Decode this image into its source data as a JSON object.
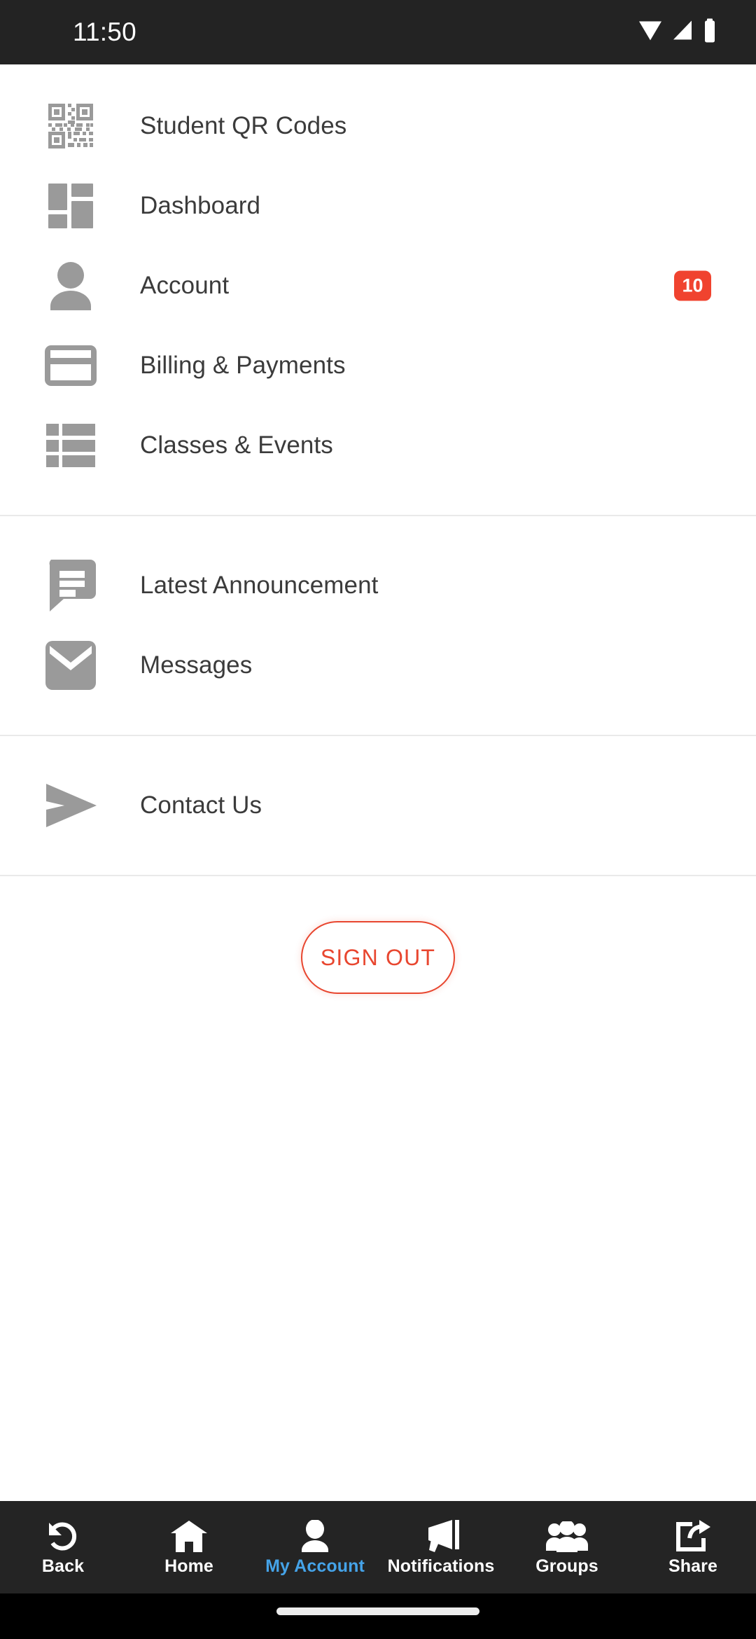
{
  "status_bar": {
    "time": "11:50",
    "icons": [
      "wifi-icon",
      "cell-signal-icon",
      "battery-icon"
    ],
    "background": "#232323"
  },
  "menu": {
    "groups": [
      {
        "items": [
          {
            "label": "Student QR Codes",
            "icon": "qr-code-icon",
            "badge": null
          },
          {
            "label": "Dashboard",
            "icon": "dashboard-grid-icon",
            "badge": null
          },
          {
            "label": "Account",
            "icon": "person-icon",
            "badge": "10"
          },
          {
            "label": "Billing & Payments",
            "icon": "credit-card-icon",
            "badge": null
          },
          {
            "label": "Classes & Events",
            "icon": "list-icon",
            "badge": null
          }
        ]
      },
      {
        "items": [
          {
            "label": "Latest Announcement",
            "icon": "speech-bubble-icon",
            "badge": null
          },
          {
            "label": "Messages",
            "icon": "envelope-icon",
            "badge": null
          }
        ]
      },
      {
        "items": [
          {
            "label": "Contact Us",
            "icon": "paper-plane-icon",
            "badge": null
          }
        ]
      }
    ],
    "icon_color": "#9a9a9a",
    "label_color": "#3b3b3b",
    "badge_color": "#f0432f"
  },
  "sign_out": {
    "label": "SIGN OUT",
    "accent_color": "#e8462f"
  },
  "bottom_nav": {
    "active_color": "#45a3e8",
    "background": "#242424",
    "items": [
      {
        "label": "Back",
        "icon": "undo-arrow-icon",
        "active": false
      },
      {
        "label": "Home",
        "icon": "home-icon",
        "active": false
      },
      {
        "label": "My Account",
        "icon": "person-icon",
        "active": true
      },
      {
        "label": "Notifications",
        "icon": "megaphone-icon",
        "active": false
      },
      {
        "label": "Groups",
        "icon": "people-group-icon",
        "active": false
      },
      {
        "label": "Share",
        "icon": "share-icon",
        "active": false
      }
    ]
  },
  "gesture_bar": {
    "handle": "home-gesture-handle"
  }
}
